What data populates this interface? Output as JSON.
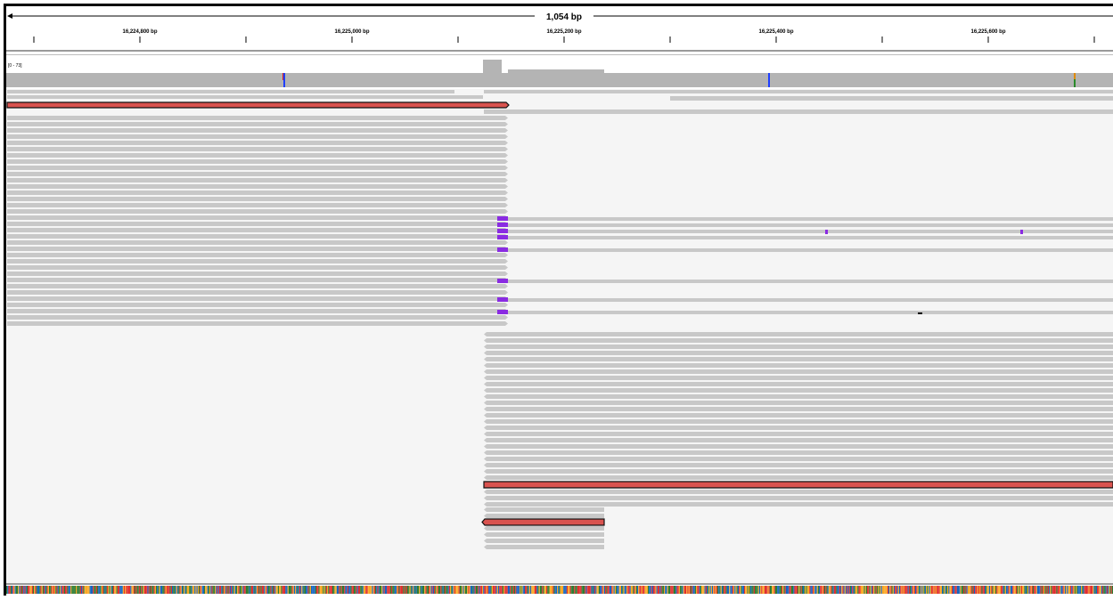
{
  "ruler": {
    "span_label": "1,054 bp",
    "ticks": [
      {
        "label": "16,224,800 bp",
        "major": true
      },
      {
        "label": "",
        "major": false
      },
      {
        "label": "16,225,000 bp",
        "major": true
      },
      {
        "label": "",
        "major": false
      },
      {
        "label": "16,225,200 bp",
        "major": true
      },
      {
        "label": "",
        "major": false
      },
      {
        "label": "16,225,400 bp",
        "major": true
      },
      {
        "label": "",
        "major": false
      },
      {
        "label": "16,225,600 bp",
        "major": true
      },
      {
        "label": "",
        "major": false
      }
    ]
  },
  "coverage": {
    "range_label": "[0 - 73]"
  },
  "colors": {
    "read": "#c8c8c8",
    "read_border": "#b4b4b4",
    "highlight_read": "#d9534f",
    "insertion": "#8a2be2",
    "coverage": "#b4b4b4",
    "mismatch_blue": "#1f3fff",
    "mismatch_red": "#d22",
    "mismatch_green": "#2a8a2a",
    "mismatch_orange": "#e08a00",
    "sequence_colors": [
      "#e03030",
      "#2e7d32",
      "#1565c0",
      "#f9a825"
    ]
  }
}
